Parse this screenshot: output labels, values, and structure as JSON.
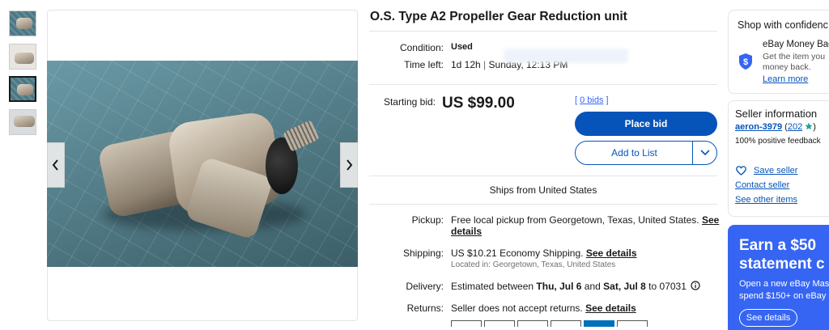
{
  "listing": {
    "title": "O.S. Type A2 Propeller Gear Reduction unit",
    "condition_label": "Condition:",
    "condition_value": "Used",
    "time_left_label": "Time left:",
    "time_left_value": "1d 12h",
    "time_left_separator": "|",
    "time_left_end": "Sunday, 12:13 PM",
    "starting_bid_label": "Starting bid:",
    "starting_bid_value": "US $99.00",
    "bids_open": "[",
    "bids_link": "0 bids",
    "bids_close": "]",
    "place_bid_label": "Place bid",
    "add_to_list_label": "Add to List",
    "ships_from": "Ships from United States"
  },
  "details": {
    "pickup_label": "Pickup:",
    "pickup_text": "Free local pickup from Georgetown, Texas, United States.",
    "pickup_link_1": "See",
    "pickup_link_2": "details",
    "shipping_label": "Shipping:",
    "shipping_price": "US $10.21",
    "shipping_method": "Economy Shipping.",
    "shipping_link": "See details",
    "located_in": "Located in: Georgetown, Texas, United States",
    "delivery_label": "Delivery:",
    "delivery_prefix": "Estimated between",
    "delivery_start": "Thu, Jul 6",
    "delivery_and": "and",
    "delivery_end": "Sat, Jul 8",
    "delivery_to": "to 07031",
    "returns_label": "Returns:",
    "returns_text": "Seller does not accept returns.",
    "returns_link": "See details"
  },
  "confidence": {
    "title": "Shop with confidenc",
    "item_title": "eBay Money Bac",
    "item_text_1": "Get the item you",
    "item_text_2": "money back.",
    "learn_more": "Learn more"
  },
  "seller": {
    "title": "Seller information",
    "name": "aeron-3979",
    "feedback_open": "(",
    "feedback_count": "202",
    "feedback_close": ")",
    "positive": "100% positive feedback",
    "save_seller": "Save seller",
    "contact_seller": "Contact seller",
    "see_other_items": "See other items"
  },
  "promo": {
    "headline_1": "Earn a $50",
    "headline_2": "statement c",
    "body_1": "Open a new eBay Mas",
    "body_2": "spend $150+ on eBay",
    "button": "See details"
  },
  "colors": {
    "primary": "#0654ba",
    "promo_bg": "#3665f3",
    "star": "#1ea39c"
  },
  "icons": {
    "prev": "chevron-left-icon",
    "next": "chevron-right-icon",
    "dropdown": "chevron-down-icon",
    "info": "info-icon",
    "shield": "shield-icon",
    "heart": "heart-icon",
    "star": "star-icon"
  }
}
